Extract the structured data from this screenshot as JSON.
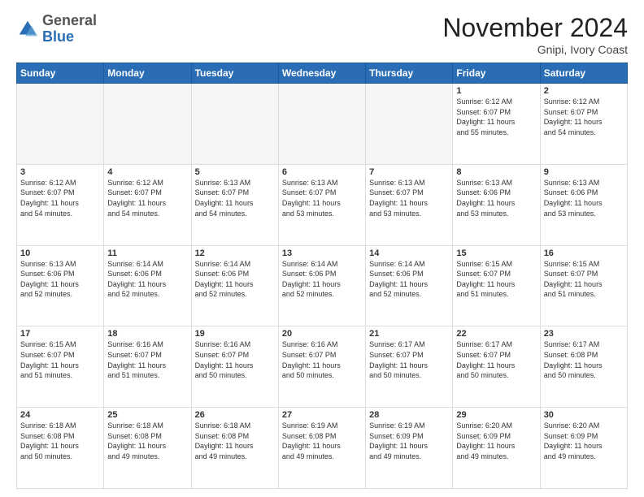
{
  "header": {
    "logo_general": "General",
    "logo_blue": "Blue",
    "month_title": "November 2024",
    "location": "Gnipi, Ivory Coast"
  },
  "days_of_week": [
    "Sunday",
    "Monday",
    "Tuesday",
    "Wednesday",
    "Thursday",
    "Friday",
    "Saturday"
  ],
  "weeks": [
    [
      {
        "day": "",
        "info": ""
      },
      {
        "day": "",
        "info": ""
      },
      {
        "day": "",
        "info": ""
      },
      {
        "day": "",
        "info": ""
      },
      {
        "day": "",
        "info": ""
      },
      {
        "day": "1",
        "info": "Sunrise: 6:12 AM\nSunset: 6:07 PM\nDaylight: 11 hours\nand 55 minutes."
      },
      {
        "day": "2",
        "info": "Sunrise: 6:12 AM\nSunset: 6:07 PM\nDaylight: 11 hours\nand 54 minutes."
      }
    ],
    [
      {
        "day": "3",
        "info": "Sunrise: 6:12 AM\nSunset: 6:07 PM\nDaylight: 11 hours\nand 54 minutes."
      },
      {
        "day": "4",
        "info": "Sunrise: 6:12 AM\nSunset: 6:07 PM\nDaylight: 11 hours\nand 54 minutes."
      },
      {
        "day": "5",
        "info": "Sunrise: 6:13 AM\nSunset: 6:07 PM\nDaylight: 11 hours\nand 54 minutes."
      },
      {
        "day": "6",
        "info": "Sunrise: 6:13 AM\nSunset: 6:07 PM\nDaylight: 11 hours\nand 53 minutes."
      },
      {
        "day": "7",
        "info": "Sunrise: 6:13 AM\nSunset: 6:07 PM\nDaylight: 11 hours\nand 53 minutes."
      },
      {
        "day": "8",
        "info": "Sunrise: 6:13 AM\nSunset: 6:06 PM\nDaylight: 11 hours\nand 53 minutes."
      },
      {
        "day": "9",
        "info": "Sunrise: 6:13 AM\nSunset: 6:06 PM\nDaylight: 11 hours\nand 53 minutes."
      }
    ],
    [
      {
        "day": "10",
        "info": "Sunrise: 6:13 AM\nSunset: 6:06 PM\nDaylight: 11 hours\nand 52 minutes."
      },
      {
        "day": "11",
        "info": "Sunrise: 6:14 AM\nSunset: 6:06 PM\nDaylight: 11 hours\nand 52 minutes."
      },
      {
        "day": "12",
        "info": "Sunrise: 6:14 AM\nSunset: 6:06 PM\nDaylight: 11 hours\nand 52 minutes."
      },
      {
        "day": "13",
        "info": "Sunrise: 6:14 AM\nSunset: 6:06 PM\nDaylight: 11 hours\nand 52 minutes."
      },
      {
        "day": "14",
        "info": "Sunrise: 6:14 AM\nSunset: 6:06 PM\nDaylight: 11 hours\nand 52 minutes."
      },
      {
        "day": "15",
        "info": "Sunrise: 6:15 AM\nSunset: 6:07 PM\nDaylight: 11 hours\nand 51 minutes."
      },
      {
        "day": "16",
        "info": "Sunrise: 6:15 AM\nSunset: 6:07 PM\nDaylight: 11 hours\nand 51 minutes."
      }
    ],
    [
      {
        "day": "17",
        "info": "Sunrise: 6:15 AM\nSunset: 6:07 PM\nDaylight: 11 hours\nand 51 minutes."
      },
      {
        "day": "18",
        "info": "Sunrise: 6:16 AM\nSunset: 6:07 PM\nDaylight: 11 hours\nand 51 minutes."
      },
      {
        "day": "19",
        "info": "Sunrise: 6:16 AM\nSunset: 6:07 PM\nDaylight: 11 hours\nand 50 minutes."
      },
      {
        "day": "20",
        "info": "Sunrise: 6:16 AM\nSunset: 6:07 PM\nDaylight: 11 hours\nand 50 minutes."
      },
      {
        "day": "21",
        "info": "Sunrise: 6:17 AM\nSunset: 6:07 PM\nDaylight: 11 hours\nand 50 minutes."
      },
      {
        "day": "22",
        "info": "Sunrise: 6:17 AM\nSunset: 6:07 PM\nDaylight: 11 hours\nand 50 minutes."
      },
      {
        "day": "23",
        "info": "Sunrise: 6:17 AM\nSunset: 6:08 PM\nDaylight: 11 hours\nand 50 minutes."
      }
    ],
    [
      {
        "day": "24",
        "info": "Sunrise: 6:18 AM\nSunset: 6:08 PM\nDaylight: 11 hours\nand 50 minutes."
      },
      {
        "day": "25",
        "info": "Sunrise: 6:18 AM\nSunset: 6:08 PM\nDaylight: 11 hours\nand 49 minutes."
      },
      {
        "day": "26",
        "info": "Sunrise: 6:18 AM\nSunset: 6:08 PM\nDaylight: 11 hours\nand 49 minutes."
      },
      {
        "day": "27",
        "info": "Sunrise: 6:19 AM\nSunset: 6:08 PM\nDaylight: 11 hours\nand 49 minutes."
      },
      {
        "day": "28",
        "info": "Sunrise: 6:19 AM\nSunset: 6:09 PM\nDaylight: 11 hours\nand 49 minutes."
      },
      {
        "day": "29",
        "info": "Sunrise: 6:20 AM\nSunset: 6:09 PM\nDaylight: 11 hours\nand 49 minutes."
      },
      {
        "day": "30",
        "info": "Sunrise: 6:20 AM\nSunset: 6:09 PM\nDaylight: 11 hours\nand 49 minutes."
      }
    ]
  ]
}
